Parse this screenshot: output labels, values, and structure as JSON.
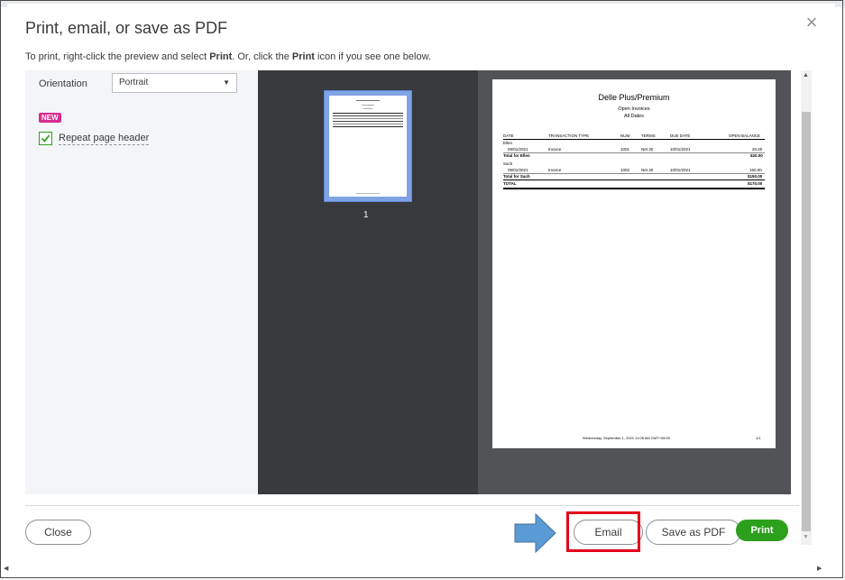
{
  "dialog": {
    "title": "Print, email, or save as PDF",
    "close_icon": "×",
    "instructions": {
      "part1": "To print, right-click the preview and select ",
      "bold1": "Print",
      "part2": ". Or, click the ",
      "bold2": "Print",
      "part3": " icon if you see one below."
    }
  },
  "options": {
    "orientation_label": "Orientation",
    "orientation_value": "Portrait",
    "new_badge": "NEW",
    "repeat_header_label": "Repeat page header",
    "repeat_header_checked": true
  },
  "preview": {
    "thumbnail_page_number": "1",
    "report": {
      "company": "Delle Plus/Premium",
      "title": "Open Invoices",
      "subtitle": "All Dates",
      "columns": [
        "DATE",
        "TRANSACTION TYPE",
        "NUM",
        "TERMS",
        "DUE DATE",
        "OPEN BALANCE"
      ],
      "groups": [
        {
          "name": "Ellen",
          "rows": [
            {
              "date": "09/01/2021",
              "type": "Invoice",
              "num": "1001",
              "terms": "Net 30",
              "due": "10/01/2021",
              "balance": "20.00"
            }
          ],
          "total_label": "Total for Ellen",
          "total_value": "$20.00"
        },
        {
          "name": "Sach",
          "rows": [
            {
              "date": "09/01/2021",
              "type": "Invoice",
              "num": "1002",
              "terms": "Net 30",
              "due": "10/01/2021",
              "balance": "150.00"
            }
          ],
          "total_label": "Total for Sach",
          "total_value": "$150.00"
        }
      ],
      "grand_total_label": "TOTAL",
      "grand_total_value": "$170.00",
      "footer": "Wednesday, September 1, 2021 11:08 AM GMT+08:00",
      "page_number": "1/1"
    }
  },
  "buttons": {
    "close": "Close",
    "email": "Email",
    "save_pdf": "Save as PDF",
    "print": "Print"
  },
  "colors": {
    "accent_green": "#2ca01c",
    "badge_pink": "#d52b8f",
    "highlight_red": "#e3001b",
    "arrow_blue": "#5b9bd5"
  },
  "icons": {
    "close": "close-icon",
    "checkbox": "checkmark-icon",
    "dropdown": "caret-down-icon",
    "arrow": "arrow-right-icon"
  }
}
